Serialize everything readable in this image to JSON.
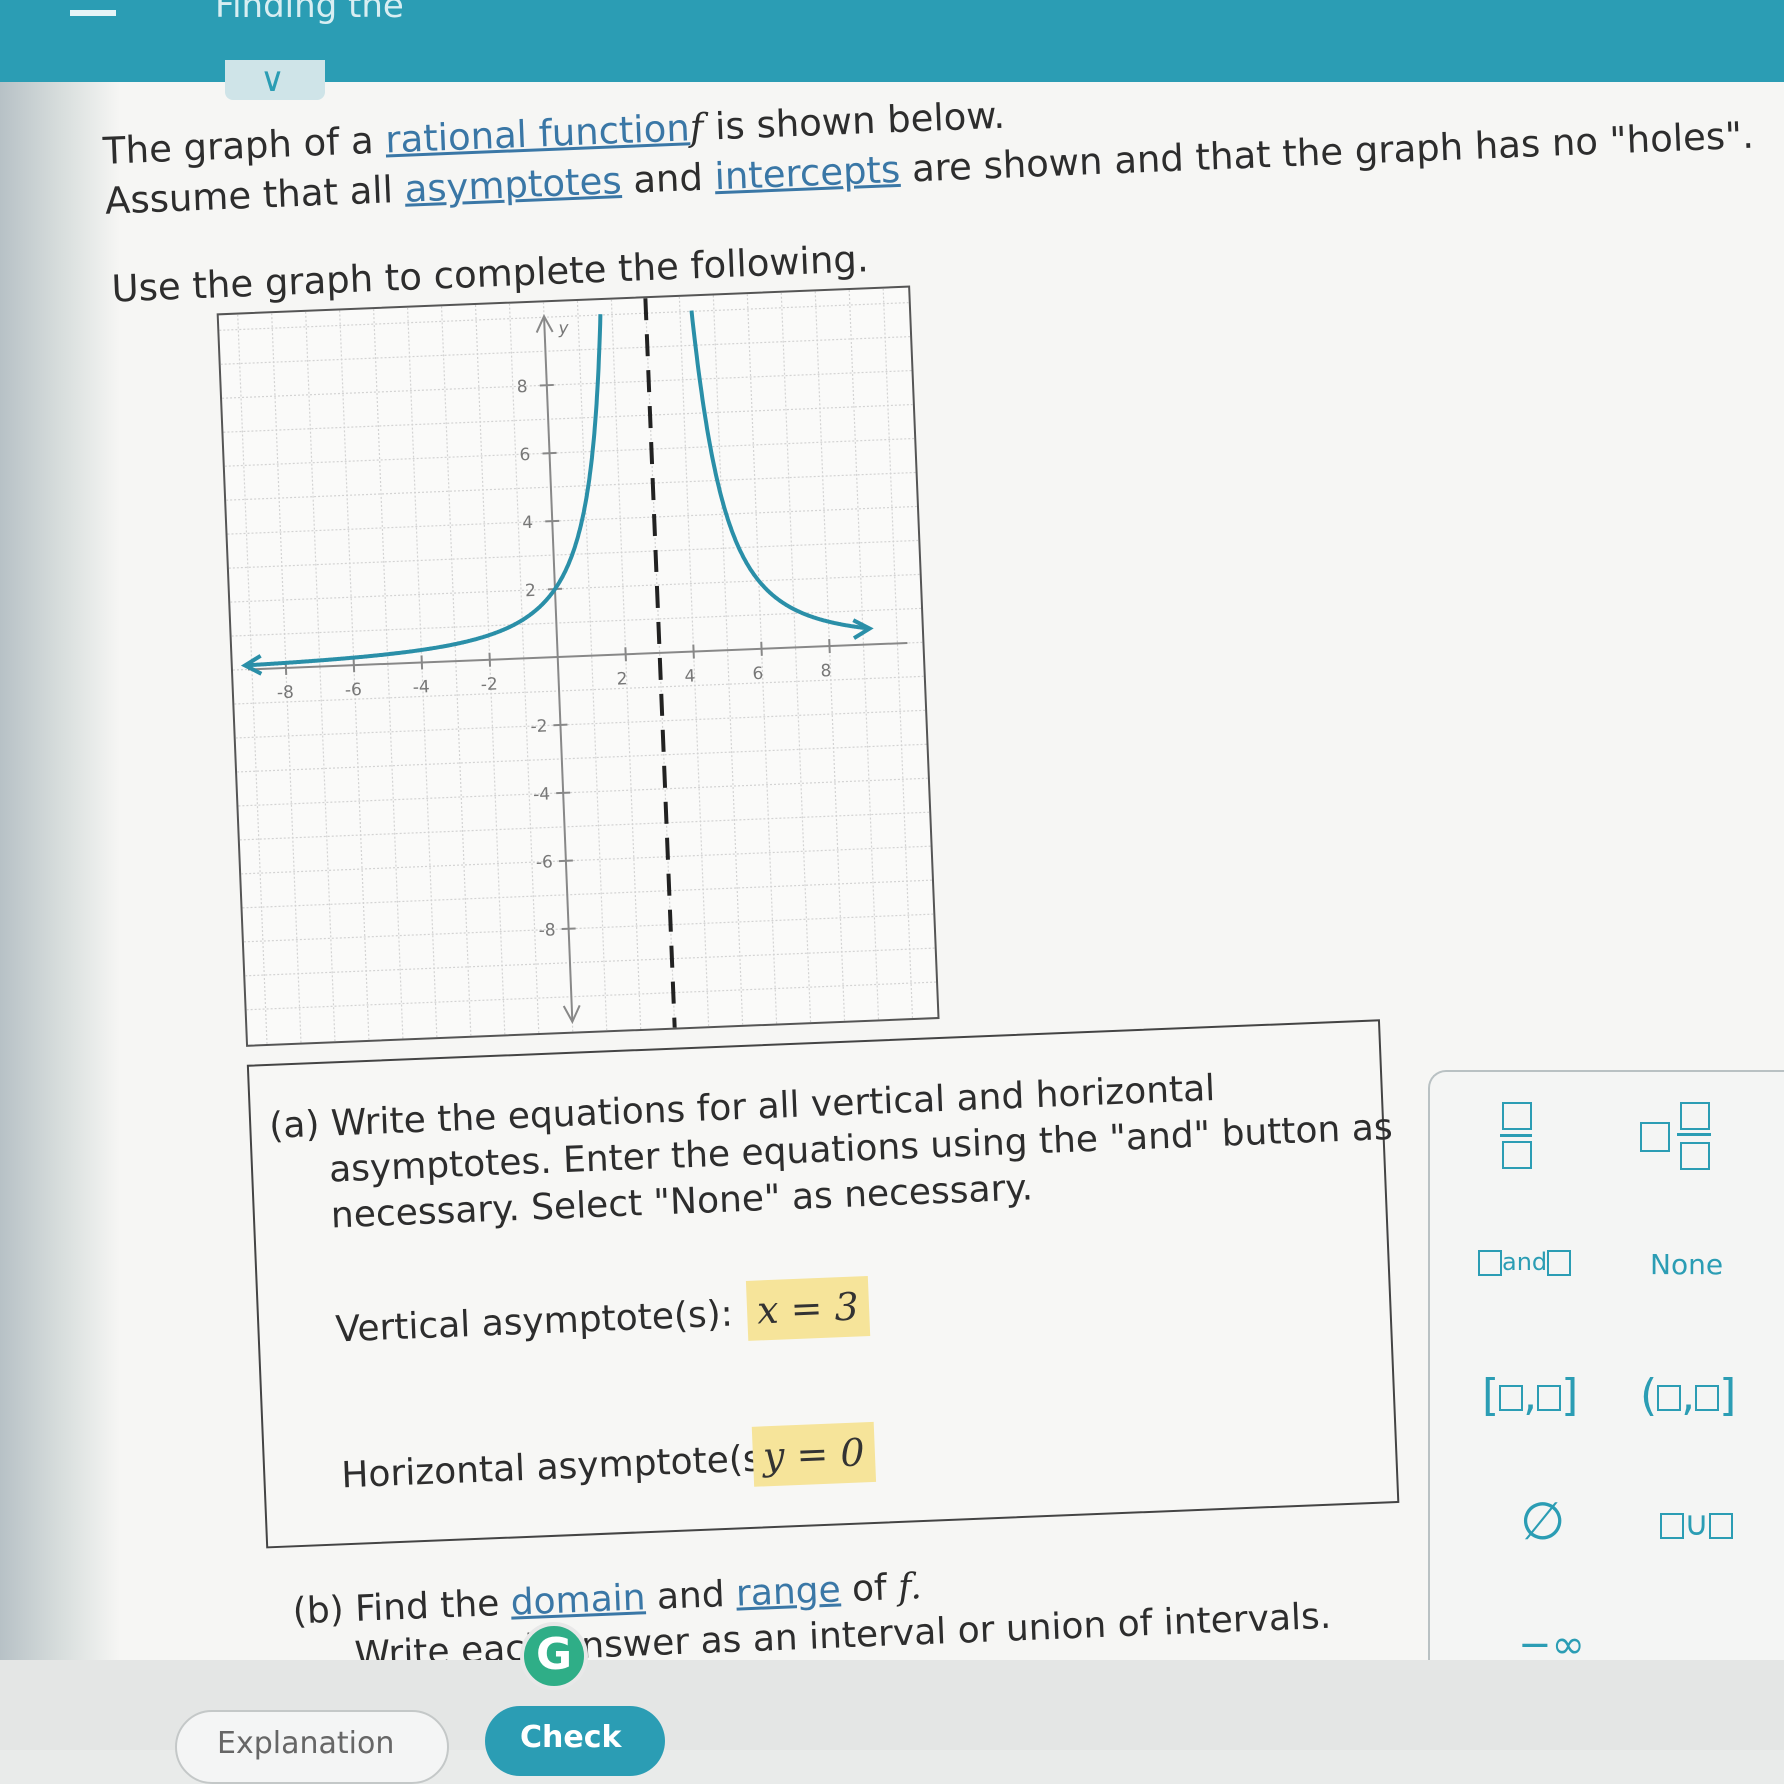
{
  "header": {
    "title": "Finding the"
  },
  "problem": {
    "line1_pre": "The graph of a ",
    "rational_function_link": "rational function",
    "f_symbol": "f",
    "line1_post": " is shown below.",
    "line2_pre": "Assume that all ",
    "asymptotes_link": "asymptotes",
    "line2_mid": " and ",
    "intercepts_link": "intercepts",
    "line2_post": " are shown and that the graph has no \"holes\".",
    "instruction": "Use the graph to complete the following."
  },
  "graph": {
    "y_label": "y",
    "x_ticks": [
      "-8",
      "-6",
      "-4",
      "-2",
      "2",
      "4",
      "6",
      "8"
    ],
    "y_ticks": [
      "8",
      "6",
      "4",
      "2",
      "-2",
      "-4",
      "-6",
      "-8"
    ],
    "vertical_asymptote_x": 3,
    "horizontal_asymptote_y": 0,
    "y_intercept": 2,
    "curve_color": "#2a8fa8"
  },
  "part_a": {
    "line1": "(a) Write the equations for all vertical and horizontal",
    "line2": "asymptotes. Enter the equations using the \"and\" button as",
    "line3": "necessary. Select \"None\" as necessary.",
    "vertical_label": "Vertical asymptote(s):",
    "vertical_answer": "x = 3",
    "horizontal_label": "Horizontal asymptote(s):",
    "horizontal_answer": "y = 0"
  },
  "part_b": {
    "line1_pre": "(b) Find the ",
    "domain_link": "domain",
    "line1_mid": " and ",
    "range_link": "range",
    "line1_post": " of ",
    "f_symbol": "f.",
    "line2": "Write each answer as an interval or union of intervals."
  },
  "palette": {
    "and_label": "and",
    "none_label": "None",
    "empty_set": "∅",
    "neg_infinity": "−∞"
  },
  "footer": {
    "explanation_label": "Explanation",
    "check_label": "Check",
    "badge_letter": "G"
  }
}
